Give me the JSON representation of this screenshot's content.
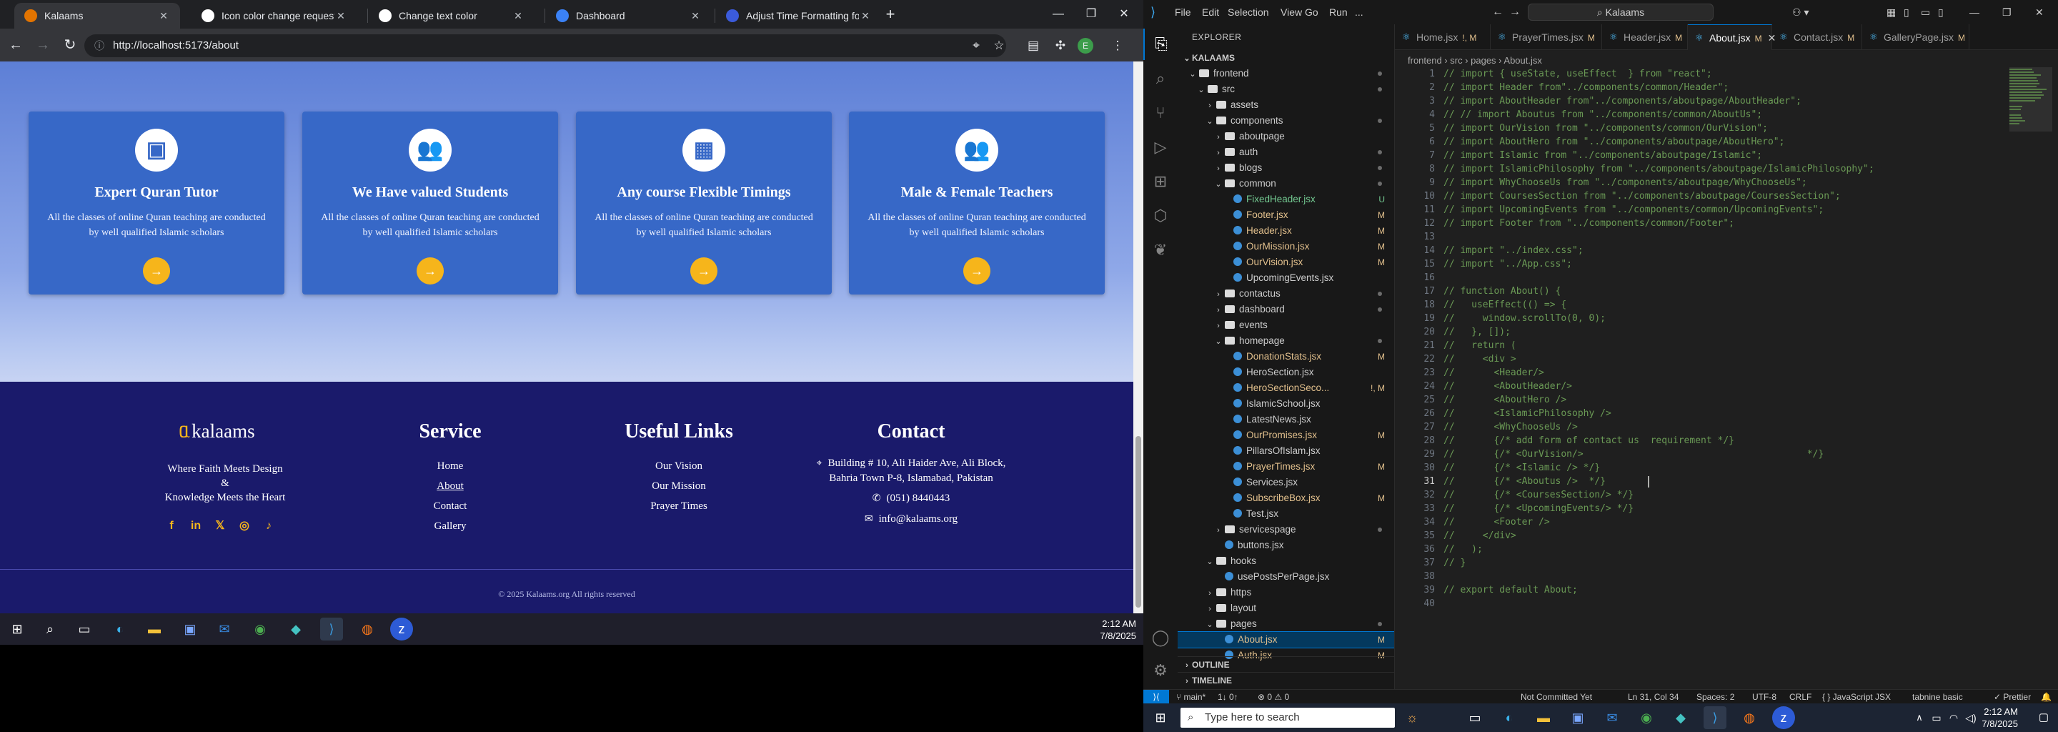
{
  "browser": {
    "tabs": [
      {
        "title": "Kalaams",
        "active": true,
        "color": "#e37400"
      },
      {
        "title": "Icon color change request",
        "active": false,
        "color": "#ffffff"
      },
      {
        "title": "Change text color",
        "active": false,
        "color": "#ffffff"
      },
      {
        "title": "Dashboard",
        "active": false,
        "color": "#3b82f6"
      },
      {
        "title": "Adjust Time Formatting for AM",
        "active": false,
        "color": "#3b5bdb"
      }
    ],
    "url": "http://localhost:5173/about",
    "new_tab": "+"
  },
  "site": {
    "cards": [
      {
        "icon": "presentation-icon",
        "glyph": "▣",
        "title": "Expert Quran Tutor",
        "desc": "All the classes of online Quran teaching are conducted by well qualified Islamic scholars"
      },
      {
        "icon": "users-icon",
        "glyph": "👥",
        "title": "We Have valued Students",
        "desc": "All the classes of online Quran teaching are conducted by well qualified Islamic scholars"
      },
      {
        "icon": "calendar-icon",
        "glyph": "▦",
        "title": "Any course Flexible Timings",
        "desc": "All the classes of online Quran teaching are conducted by well qualified Islamic scholars"
      },
      {
        "icon": "teachers-icon",
        "glyph": "👥",
        "title": "Male & Female Teachers",
        "desc": "All the classes of online Quran teaching are conducted by well qualified Islamic scholars"
      }
    ],
    "arrow": "→",
    "footer": {
      "logo": "kalaams",
      "tagline1": "Where Faith Meets Design",
      "tagline2": "&",
      "tagline3": "Knowledge Meets the Heart",
      "service_title": "Service",
      "service_links": [
        "Home",
        "About",
        "Contact",
        "Gallery"
      ],
      "useful_title": "Useful Links",
      "useful_links": [
        "Our Vision",
        "Our Mission",
        "Prayer Times"
      ],
      "contact_title": "Contact",
      "address1": "Building # 10, Ali Haider Ave, Ali Block,",
      "address2": "Bahria Town P-8, Islamabad, Pakistan",
      "phone": "(051) 8440443",
      "email": "info@kalaams.org",
      "copyright": "© 2025 Kalaams.org All rights reserved"
    }
  },
  "taskbar_left": {
    "time": "2:12 AM",
    "date": "7/8/2025"
  },
  "vscode": {
    "menu": [
      "File",
      "Edit",
      "Selection",
      "View",
      "Go",
      "Run",
      "..."
    ],
    "search": "Kalaams",
    "explorer_title": "EXPLORER",
    "project": "KALAAMS",
    "tree": [
      {
        "d": 0,
        "n": "frontend",
        "t": "dir",
        "open": true,
        "dot": true
      },
      {
        "d": 1,
        "n": "src",
        "t": "dir",
        "open": true,
        "dot": true
      },
      {
        "d": 2,
        "n": "assets",
        "t": "dir",
        "open": false
      },
      {
        "d": 2,
        "n": "components",
        "t": "dir",
        "open": true,
        "dot": true
      },
      {
        "d": 3,
        "n": "aboutpage",
        "t": "dir",
        "open": false
      },
      {
        "d": 3,
        "n": "auth",
        "t": "dir",
        "open": false,
        "dot": true
      },
      {
        "d": 3,
        "n": "blogs",
        "t": "dir",
        "open": false,
        "dot": true
      },
      {
        "d": 3,
        "n": "common",
        "t": "dir",
        "open": true,
        "dot": true
      },
      {
        "d": 4,
        "n": "FixedHeader.jsx",
        "t": "file",
        "badge": "U",
        "bc": "#73c991",
        "nc": "#73c991"
      },
      {
        "d": 4,
        "n": "Footer.jsx",
        "t": "file",
        "badge": "M",
        "bc": "#e2c08d",
        "nc": "#e2c08d"
      },
      {
        "d": 4,
        "n": "Header.jsx",
        "t": "file",
        "badge": "M",
        "bc": "#e2c08d",
        "nc": "#e2c08d"
      },
      {
        "d": 4,
        "n": "OurMission.jsx",
        "t": "file",
        "badge": "M",
        "bc": "#e2c08d",
        "nc": "#e2c08d"
      },
      {
        "d": 4,
        "n": "OurVision.jsx",
        "t": "file",
        "badge": "M",
        "bc": "#e2c08d",
        "nc": "#e2c08d"
      },
      {
        "d": 4,
        "n": "UpcomingEvents.jsx",
        "t": "file"
      },
      {
        "d": 3,
        "n": "contactus",
        "t": "dir",
        "open": false,
        "dot": true
      },
      {
        "d": 3,
        "n": "dashboard",
        "t": "dir",
        "open": false,
        "dot": true
      },
      {
        "d": 3,
        "n": "events",
        "t": "dir",
        "open": false
      },
      {
        "d": 3,
        "n": "homepage",
        "t": "dir",
        "open": true,
        "dot": true
      },
      {
        "d": 4,
        "n": "DonationStats.jsx",
        "t": "file",
        "badge": "M",
        "bc": "#e2c08d",
        "nc": "#e2c08d"
      },
      {
        "d": 4,
        "n": "HeroSection.jsx",
        "t": "file"
      },
      {
        "d": 4,
        "n": "HeroSectionSeco...",
        "t": "file",
        "badge": "!, M",
        "bc": "#e2c08d",
        "nc": "#e2c08d"
      },
      {
        "d": 4,
        "n": "IslamicSchool.jsx",
        "t": "file"
      },
      {
        "d": 4,
        "n": "LatestNews.jsx",
        "t": "file"
      },
      {
        "d": 4,
        "n": "OurPromises.jsx",
        "t": "file",
        "badge": "M",
        "bc": "#e2c08d",
        "nc": "#e2c08d"
      },
      {
        "d": 4,
        "n": "PillarsOfIslam.jsx",
        "t": "file"
      },
      {
        "d": 4,
        "n": "PrayerTimes.jsx",
        "t": "file",
        "badge": "M",
        "bc": "#e2c08d",
        "nc": "#e2c08d"
      },
      {
        "d": 4,
        "n": "Services.jsx",
        "t": "file"
      },
      {
        "d": 4,
        "n": "SubscribeBox.jsx",
        "t": "file",
        "badge": "M",
        "bc": "#e2c08d",
        "nc": "#e2c08d"
      },
      {
        "d": 4,
        "n": "Test.jsx",
        "t": "file"
      },
      {
        "d": 3,
        "n": "servicespage",
        "t": "dir",
        "open": false,
        "dot": true
      },
      {
        "d": 3,
        "n": "buttons.jsx",
        "t": "file"
      },
      {
        "d": 2,
        "n": "hooks",
        "t": "dir",
        "open": true
      },
      {
        "d": 3,
        "n": "usePostsPerPage.jsx",
        "t": "file"
      },
      {
        "d": 2,
        "n": "https",
        "t": "dir",
        "open": false
      },
      {
        "d": 2,
        "n": "layout",
        "t": "dir",
        "open": false
      },
      {
        "d": 2,
        "n": "pages",
        "t": "dir",
        "open": true,
        "dot": true
      },
      {
        "d": 3,
        "n": "About.jsx",
        "t": "file",
        "badge": "M",
        "bc": "#e2c08d",
        "nc": "#e2c08d",
        "sel": true
      },
      {
        "d": 3,
        "n": "Auth.jsx",
        "t": "file",
        "badge": "M",
        "bc": "#e2c08d",
        "nc": "#e2c08d"
      }
    ],
    "outline": "OUTLINE",
    "timeline": "TIMELINE",
    "tabs": [
      {
        "name": "Home.jsx",
        "mod": "!, M"
      },
      {
        "name": "PrayerTimes.jsx",
        "mod": "M"
      },
      {
        "name": "Header.jsx",
        "mod": "M"
      },
      {
        "name": "About.jsx",
        "mod": "M",
        "active": true
      },
      {
        "name": "Contact.jsx",
        "mod": "M"
      },
      {
        "name": "GalleryPage.jsx",
        "mod": "M"
      }
    ],
    "breadcrumb": "frontend  ›  src  ›  pages  ›  About.jsx",
    "code": [
      "// import { useState, useEffect  } from \"react\";",
      "// import Header from\"../components/common/Header\";",
      "// import AboutHeader from\"../components/aboutpage/AboutHeader\";",
      "// // import Aboutus from \"../components/common/AboutUs\";",
      "// import OurVision from \"../components/common/OurVision\";",
      "// import AboutHero from \"../components/aboutpage/AboutHero\";",
      "// import Islamic from \"../components/aboutpage/Islamic\";",
      "// import IslamicPhilosophy from \"../components/aboutpage/IslamicPhilosophy\";",
      "// import WhyChooseUs from \"../components/aboutpage/WhyChooseUs\";",
      "// import CoursesSection from \"../components/aboutpage/CoursesSection\";",
      "// import UpcomingEvents from \"../components/common/UpcomingEvents\";",
      "// import Footer from \"../components/common/Footer\";",
      "",
      "// import \"../index.css\";",
      "// import \"../App.css\";",
      "",
      "// function About() {",
      "//   useEffect(() => {",
      "//     window.scrollTo(0, 0);",
      "//   }, []);",
      "//   return (",
      "//     <div >",
      "//       <Header/>",
      "//       <AboutHeader/>",
      "//       <AboutHero />",
      "//       <IslamicPhilosophy />",
      "//       <WhyChooseUs />",
      "//       {/* add form of contact us  requirement */}",
      "//       {/* <OurVision/>                                        */}",
      "//       {/* <Islamic /> */}",
      "//       {/* <Aboutus />  */}",
      "//       {/* <CoursesSection/> */}",
      "//       {/* <UpcomingEvents/> */}",
      "//       <Footer />",
      "//     </div>",
      "//   );",
      "// }",
      "",
      "// export default About;",
      ""
    ],
    "current_line": 31,
    "status": {
      "branch": "main*",
      "sync": "1↓ 0↑",
      "problems": "⊗ 0 ⚠ 0",
      "commit": "Not Committed Yet",
      "pos": "Ln 31, Col 34",
      "spaces": "Spaces: 2",
      "enc": "UTF-8",
      "eol": "CRLF",
      "lang": "{ } JavaScript JSX",
      "tabnine": "tabnine basic",
      "prettier": "✓ Prettier"
    }
  },
  "taskbar_right": {
    "search": "Type here to search",
    "time": "2:12 AM",
    "date": "7/8/2025"
  }
}
